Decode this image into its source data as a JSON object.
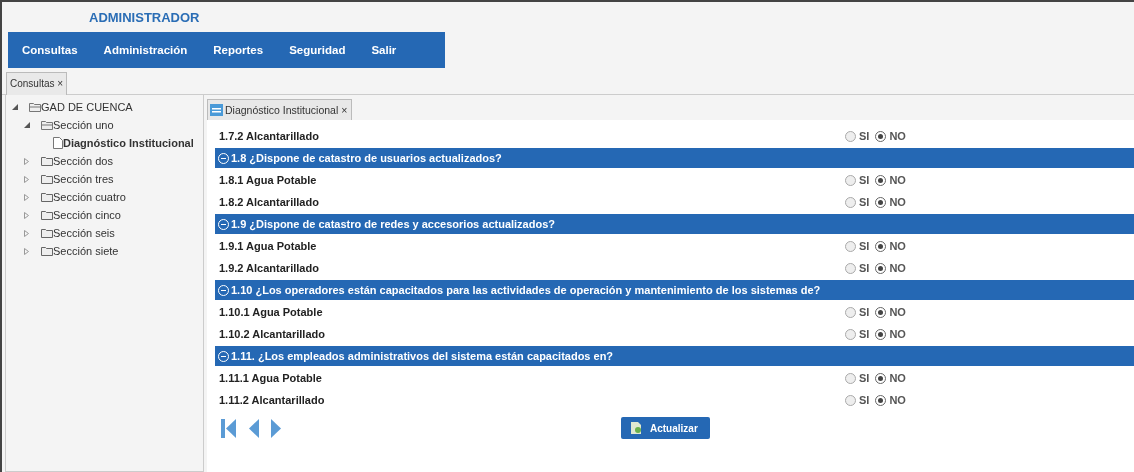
{
  "header": {
    "title": "ADMINISTRADOR"
  },
  "menu": [
    "Consultas",
    "Administración",
    "Reportes",
    "Seguridad",
    "Salir"
  ],
  "tabs": [
    {
      "label": "Consultas",
      "close": "×",
      "selected": true
    }
  ],
  "tree": [
    {
      "label": "GAD DE CUENCA",
      "expanded": true,
      "selected": false,
      "children": [
        {
          "label": "Sección uno",
          "expanded": true,
          "selected": false,
          "children": [
            {
              "label": "Diagnóstico Institucional",
              "selected": true
            }
          ]
        },
        {
          "label": "Sección dos",
          "expanded": false,
          "selected": false
        },
        {
          "label": "Sección tres",
          "expanded": false,
          "selected": false
        },
        {
          "label": "Sección cuatro",
          "expanded": false,
          "selected": false
        },
        {
          "label": "Sección cinco",
          "expanded": false,
          "selected": false
        },
        {
          "label": "Sección seis",
          "expanded": false,
          "selected": false
        },
        {
          "label": "Sección siete",
          "expanded": false,
          "selected": false
        }
      ]
    }
  ],
  "content_tabs": [
    {
      "label": "Diagnóstico Institucional",
      "close": "×",
      "selected": true
    }
  ],
  "rows": [
    {
      "kind": "item",
      "label": "1.7.2 Alcantarillado",
      "options": [
        {
          "label": "SI",
          "selected": false
        },
        {
          "label": "NO",
          "selected": true
        }
      ]
    },
    {
      "kind": "question",
      "label": "1.8 ¿Dispone de catastro de usuarios actualizados?",
      "expanded": true
    },
    {
      "kind": "item",
      "label": "1.8.1 Agua Potable",
      "options": [
        {
          "label": "SI",
          "selected": false
        },
        {
          "label": "NO",
          "selected": true
        }
      ]
    },
    {
      "kind": "item",
      "label": "1.8.2 Alcantarillado",
      "options": [
        {
          "label": "SI",
          "selected": false
        },
        {
          "label": "NO",
          "selected": true
        }
      ]
    },
    {
      "kind": "question",
      "label": "1.9 ¿Dispone de catastro de redes y accesorios actualizados?",
      "expanded": true
    },
    {
      "kind": "item",
      "label": "1.9.1 Agua Potable",
      "options": [
        {
          "label": "SI",
          "selected": false
        },
        {
          "label": "NO",
          "selected": true
        }
      ]
    },
    {
      "kind": "item",
      "label": "1.9.2 Alcantarillado",
      "options": [
        {
          "label": "SI",
          "selected": false
        },
        {
          "label": "NO",
          "selected": true
        }
      ]
    },
    {
      "kind": "question",
      "label": "1.10 ¿Los operadores están capacitados para las actividades de operación y mantenimiento de los sistemas de?",
      "expanded": true
    },
    {
      "kind": "item",
      "label": "1.10.1 Agua Potable",
      "options": [
        {
          "label": "SI",
          "selected": false
        },
        {
          "label": "NO",
          "selected": true
        }
      ]
    },
    {
      "kind": "item",
      "label": "1.10.2 Alcantarillado",
      "options": [
        {
          "label": "SI",
          "selected": false
        },
        {
          "label": "NO",
          "selected": true
        }
      ]
    },
    {
      "kind": "question",
      "label": "1.11. ¿Los empleados administrativos del sistema están capacitados en?",
      "expanded": true
    },
    {
      "kind": "item",
      "label": "1.11.1 Agua Potable",
      "options": [
        {
          "label": "SI",
          "selected": false
        },
        {
          "label": "NO",
          "selected": true
        }
      ]
    },
    {
      "kind": "item",
      "label": "1.11.2 Alcantarillado",
      "options": [
        {
          "label": "SI",
          "selected": false
        },
        {
          "label": "NO",
          "selected": true
        }
      ]
    }
  ],
  "footer": {
    "button": "Actualizar"
  }
}
